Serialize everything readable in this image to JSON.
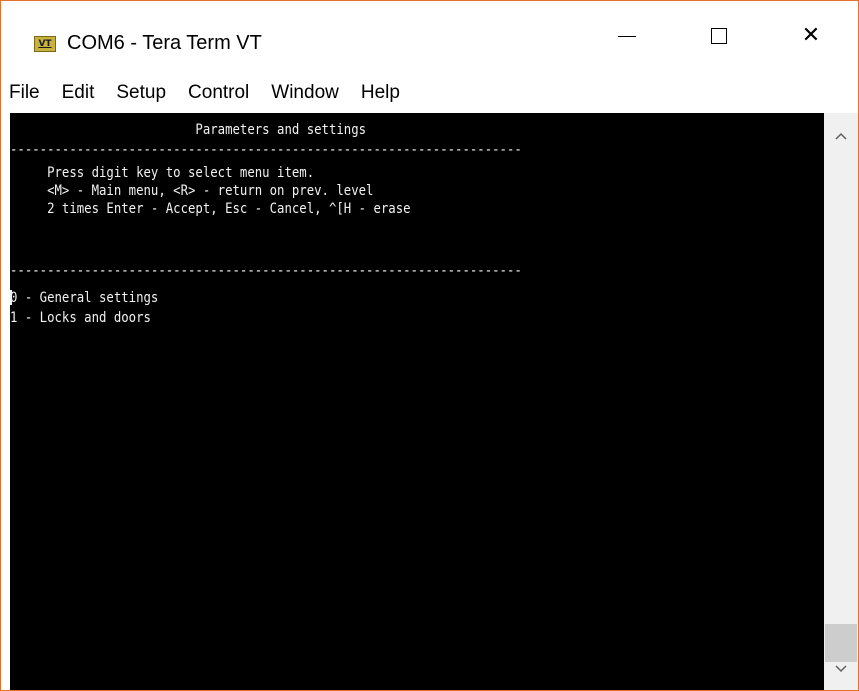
{
  "window": {
    "title": "COM6 - Tera Term VT",
    "icon": "VT",
    "accent_color": "#e0702a"
  },
  "menubar": {
    "items": [
      "File",
      "Edit",
      "Setup",
      "Control",
      "Window",
      "Help"
    ]
  },
  "terminal": {
    "background": "#000000",
    "foreground": "#f2f2f2",
    "lines": [
      "                         Parameters and settings",
      "---------------------------------------------------------------------",
      "     Press digit key to select menu item.",
      "     <M> - Main menu, <R> - return on prev. level",
      "     2 times Enter - Accept, Esc - Cancel, ^[H - erase",
      "",
      "---------------------------------------------------------------------",
      "0 - General settings",
      "1 - Locks and doors"
    ]
  },
  "scrollbar": {
    "up_icon": "chevron-up-icon",
    "down_icon": "chevron-down-icon"
  }
}
